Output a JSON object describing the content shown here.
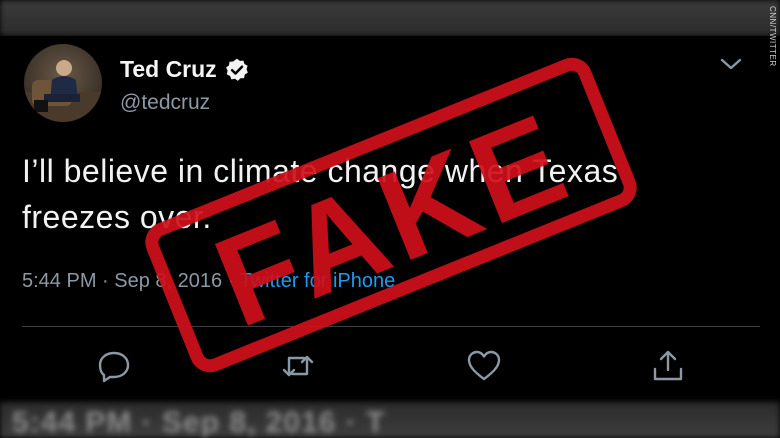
{
  "background_blur": {
    "top_text": "",
    "bottom_text": "5:44 PM · Sep 8, 2016 · T"
  },
  "credit": "CNN/TWITTER",
  "tweet": {
    "author_name": "Ted Cruz",
    "handle": "@tedcruz",
    "text_line1": "I’ll believe in climate change when Texas",
    "text_line2": "freezes over.",
    "time": "5:44 PM",
    "separator": "·",
    "date": "Sep 8, 2016",
    "source": "Twitter for iPhone"
  },
  "stamp": {
    "text": "FAKE",
    "color": "#d0101a"
  },
  "icons": {
    "verified": "verified-badge-icon",
    "menu": "chevron-down-icon",
    "reply": "reply-icon",
    "retweet": "retweet-icon",
    "like": "heart-icon",
    "share": "share-icon"
  },
  "colors": {
    "background": "#000000",
    "link": "#1d9bf0",
    "secondary_text": "#8b98a5"
  }
}
